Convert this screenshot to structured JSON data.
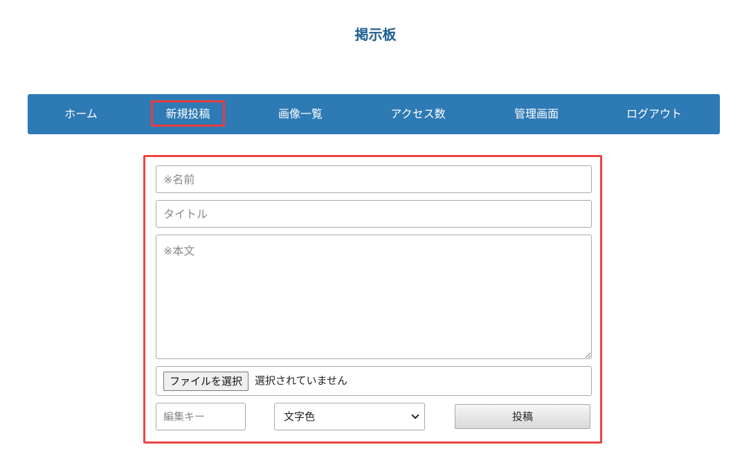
{
  "header": {
    "title": "掲示板"
  },
  "nav": {
    "items": [
      {
        "label": "ホーム",
        "active": false
      },
      {
        "label": "新規投稿",
        "active": true
      },
      {
        "label": "画像一覧",
        "active": false
      },
      {
        "label": "アクセス数",
        "active": false
      },
      {
        "label": "管理画面",
        "active": false
      },
      {
        "label": "ログアウト",
        "active": false
      }
    ]
  },
  "form": {
    "name": {
      "placeholder": "※名前",
      "value": ""
    },
    "title": {
      "placeholder": "タイトル",
      "value": ""
    },
    "body": {
      "placeholder": "※本文",
      "value": ""
    },
    "file": {
      "button_label": "ファイルを選択",
      "status": "選択されていません"
    },
    "edit_key": {
      "placeholder": "編集キー",
      "value": ""
    },
    "text_color": {
      "selected": "文字色"
    },
    "submit_label": "投稿"
  },
  "colors": {
    "title": "#1f5f8f",
    "navbar": "#2e7ab5",
    "highlight": "#ef3b3b"
  }
}
